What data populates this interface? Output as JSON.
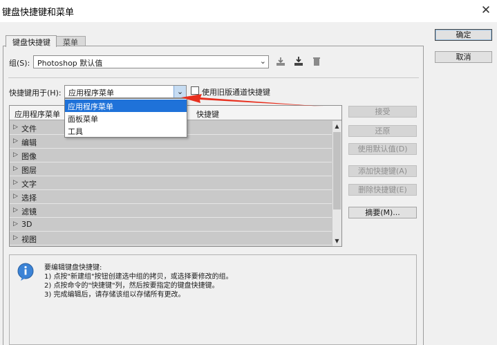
{
  "window": {
    "title": "键盘快捷键和菜单",
    "close_glyph": "✕"
  },
  "tabs": [
    {
      "label": "键盘快捷键"
    },
    {
      "label": "菜单"
    }
  ],
  "group": {
    "label": "组(S):",
    "value": "Photoshop 默认值"
  },
  "shortcuts_for": {
    "label": "快捷键用于(H):",
    "value": "应用程序菜单"
  },
  "legacy_checkbox": {
    "label": "使用旧版通道快捷键",
    "checked": false
  },
  "dropdown": {
    "options": [
      "应用程序菜单",
      "面板菜单",
      "工具"
    ],
    "selected_index": 0
  },
  "table": {
    "headers": [
      "应用程序菜单",
      "快捷键"
    ],
    "rows": [
      "文件",
      "编辑",
      "图像",
      "图层",
      "文字",
      "选择",
      "滤镜",
      "3D",
      "视图"
    ]
  },
  "side_buttons": {
    "accept": "接受",
    "undo": "还原",
    "use_default": "使用默认值(D)",
    "add_shortcut": "添加快捷键(A)",
    "delete_shortcut": "删除快捷键(E)",
    "summary": "摘要(M)..."
  },
  "dialog_buttons": {
    "ok": "确定",
    "cancel": "取消"
  },
  "info": {
    "heading": "要编辑键盘快捷键:",
    "lines": [
      "1) 点按\"新建组\"按钮创建选中组的拷贝，或选择要修改的组。",
      "2) 点按命令的\"快捷键\"列，然后按要指定的键盘快捷键。",
      "3) 完成编辑后，请存储该组以存储所有更改。"
    ]
  },
  "colors": {
    "accent": "#1f72d9",
    "annotation_arrow": "#e8301f"
  }
}
